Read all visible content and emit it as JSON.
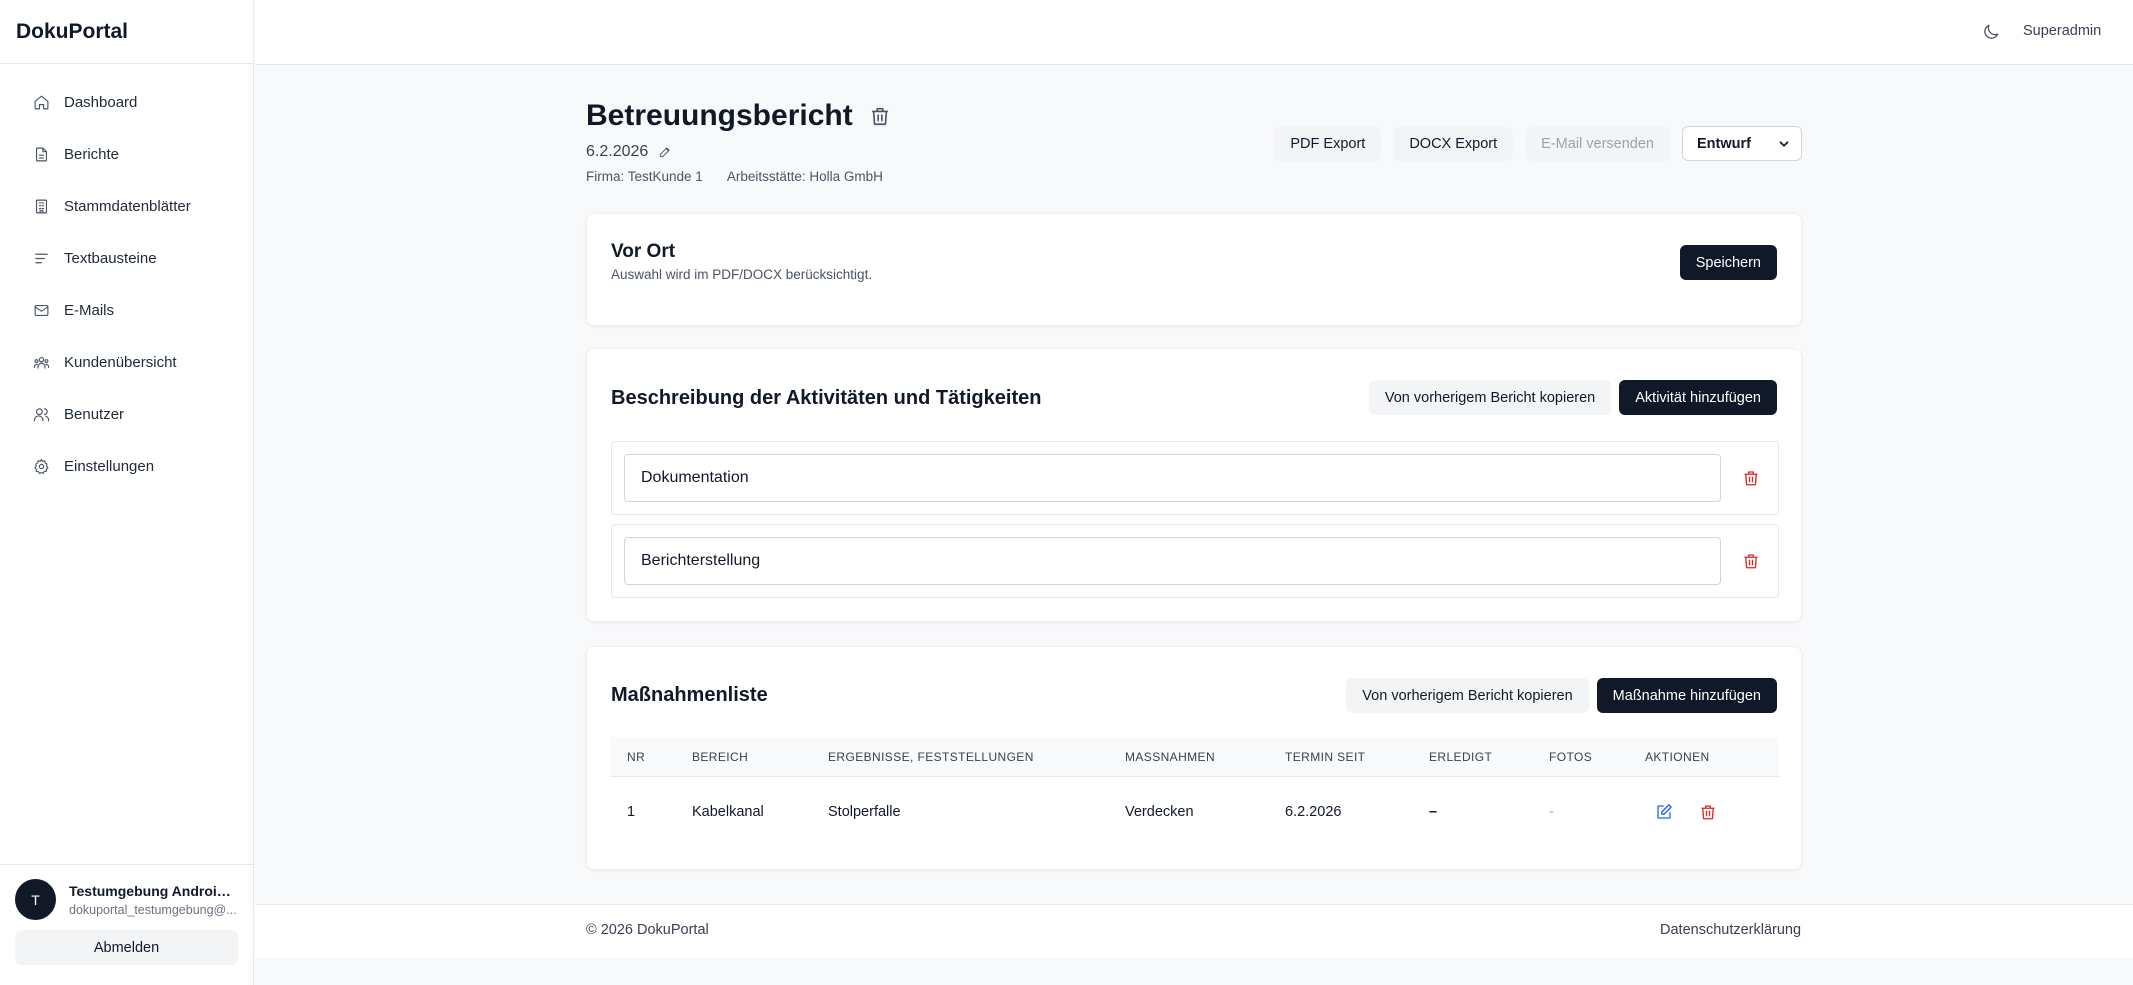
{
  "app": {
    "brand": "DokuPortal"
  },
  "sidebar": {
    "items": [
      {
        "label": "Dashboard",
        "icon": "home-icon"
      },
      {
        "label": "Berichte",
        "icon": "file-icon"
      },
      {
        "label": "Stammdatenblätter",
        "icon": "building-icon"
      },
      {
        "label": "Textbausteine",
        "icon": "text-lines-icon"
      },
      {
        "label": "E-Mails",
        "icon": "mail-icon"
      },
      {
        "label": "Kundenübersicht",
        "icon": "users-group-icon"
      },
      {
        "label": "Benutzer",
        "icon": "users-icon"
      },
      {
        "label": "Einstellungen",
        "icon": "gear-icon"
      }
    ],
    "user": {
      "initial": "T",
      "name": "Testumgebung Androidi...",
      "email": "dokuportal_testumgebung@...",
      "logout_label": "Abmelden"
    }
  },
  "topbar": {
    "role": "Superadmin",
    "theme_icon": "moon-icon"
  },
  "report": {
    "title": "Betreuungsbericht",
    "date": "6.2.2026",
    "firma": "Firma: TestKunde 1",
    "arbeitsstaette": "Arbeitsstätte: Holla GmbH",
    "actions": {
      "pdf": "PDF Export",
      "docx": "DOCX Export",
      "email": "E-Mail versenden"
    },
    "status": "Entwurf"
  },
  "vorort": {
    "title": "Vor Ort",
    "subtitle": "Auswahl wird im PDF/DOCX berücksichtigt.",
    "save_label": "Speichern"
  },
  "aktivitaeten": {
    "title": "Beschreibung der Aktivitäten und Tätigkeiten",
    "copy_label": "Von vorherigem Bericht kopieren",
    "add_label": "Aktivität hinzufügen",
    "items": [
      "Dokumentation",
      "Berichterstellung"
    ]
  },
  "massnahmen": {
    "title": "Maßnahmenliste",
    "copy_label": "Von vorherigem Bericht kopieren",
    "add_label": "Maßnahme hinzufügen",
    "columns": [
      "NR",
      "BEREICH",
      "ERGEBNISSE, FESTSTELLUNGEN",
      "MASSNAHMEN",
      "TERMIN SEIT",
      "ERLEDIGT",
      "FOTOS",
      "AKTIONEN"
    ],
    "rows": [
      {
        "nr": "1",
        "bereich": "Kabelkanal",
        "ergebnisse": "Stolperfalle",
        "massnahmen": "Verdecken",
        "termin": "6.2.2026",
        "erledigt": "–",
        "fotos": "-"
      }
    ]
  },
  "footer": {
    "copyright": "© 2026 DokuPortal",
    "privacy": "Datenschutzerklärung"
  },
  "colors": {
    "primary": "#111827",
    "danger": "#dc2626",
    "edit": "#2563eb",
    "background": "#f8f9fb"
  }
}
